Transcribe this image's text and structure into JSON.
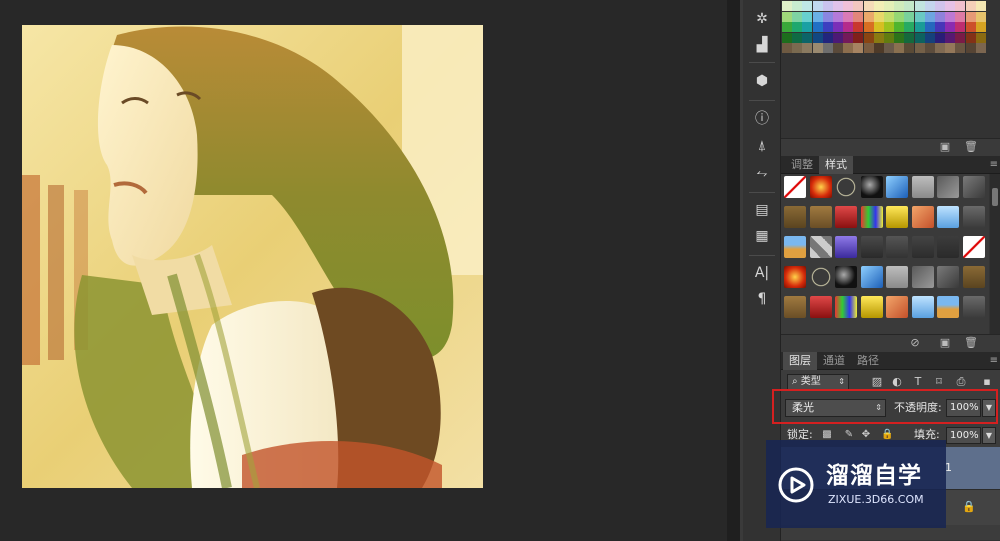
{
  "panels": {
    "adjust_tab": "调整",
    "styles_tab": "样式",
    "layers_tab": "图层",
    "channels_tab": "通道",
    "paths_tab": "路径"
  },
  "layers": {
    "filter_kind": "类型",
    "blend_mode": "柔光",
    "opacity_label": "不透明度:",
    "opacity_value": "100%",
    "lock_label": "锁定:",
    "fill_label": "填充:",
    "fill_value": "100%",
    "layer_badge": "1"
  },
  "watermark": {
    "title": "溜溜自学",
    "url": "ZIXUE.3D66.COM"
  },
  "colors": {
    "highlight": "#d42020",
    "watermark_bg": "#182652"
  }
}
